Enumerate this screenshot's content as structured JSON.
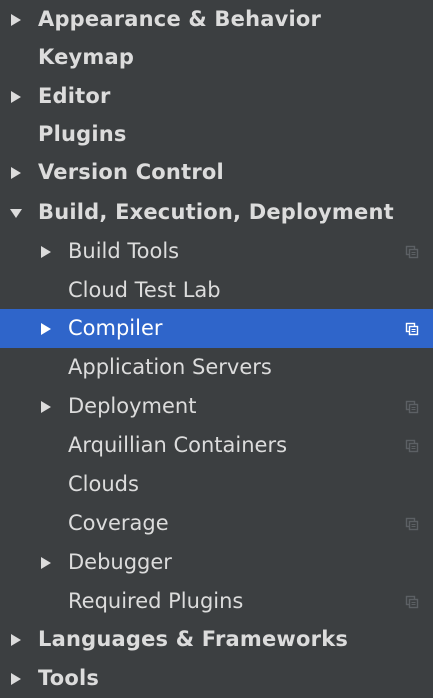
{
  "colors": {
    "background": "#3c3f41",
    "text": "#dcdcdc",
    "selection": "#2f65ca",
    "selected_text": "#ffffff",
    "icon_dim": "#5c6064",
    "icon_selected": "#ffffff"
  },
  "settings_tree": {
    "items": [
      {
        "label": "Appearance & Behavior",
        "level": 0,
        "arrow": "collapsed",
        "copy_icon": false,
        "selected": false
      },
      {
        "label": "Keymap",
        "level": 0,
        "arrow": "none",
        "copy_icon": false,
        "selected": false
      },
      {
        "label": "Editor",
        "level": 0,
        "arrow": "collapsed",
        "copy_icon": false,
        "selected": false
      },
      {
        "label": "Plugins",
        "level": 0,
        "arrow": "none",
        "copy_icon": false,
        "selected": false
      },
      {
        "label": "Version Control",
        "level": 0,
        "arrow": "collapsed",
        "copy_icon": false,
        "selected": false
      },
      {
        "label": "Build, Execution, Deployment",
        "level": 0,
        "arrow": "expanded",
        "copy_icon": false,
        "selected": false
      },
      {
        "label": "Build Tools",
        "level": 1,
        "arrow": "collapsed",
        "copy_icon": true,
        "selected": false
      },
      {
        "label": "Cloud Test Lab",
        "level": 1,
        "arrow": "none",
        "copy_icon": false,
        "selected": false
      },
      {
        "label": "Compiler",
        "level": 1,
        "arrow": "collapsed",
        "copy_icon": true,
        "selected": true
      },
      {
        "label": "Application Servers",
        "level": 1,
        "arrow": "none",
        "copy_icon": false,
        "selected": false
      },
      {
        "label": "Deployment",
        "level": 1,
        "arrow": "collapsed",
        "copy_icon": true,
        "selected": false
      },
      {
        "label": "Arquillian Containers",
        "level": 1,
        "arrow": "none",
        "copy_icon": true,
        "selected": false
      },
      {
        "label": "Clouds",
        "level": 1,
        "arrow": "none",
        "copy_icon": false,
        "selected": false
      },
      {
        "label": "Coverage",
        "level": 1,
        "arrow": "none",
        "copy_icon": true,
        "selected": false
      },
      {
        "label": "Debugger",
        "level": 1,
        "arrow": "collapsed",
        "copy_icon": false,
        "selected": false
      },
      {
        "label": "Required Plugins",
        "level": 1,
        "arrow": "none",
        "copy_icon": true,
        "selected": false
      },
      {
        "label": "Languages & Frameworks",
        "level": 0,
        "arrow": "collapsed",
        "copy_icon": false,
        "selected": false
      },
      {
        "label": "Tools",
        "level": 0,
        "arrow": "collapsed",
        "copy_icon": false,
        "selected": false
      }
    ]
  }
}
